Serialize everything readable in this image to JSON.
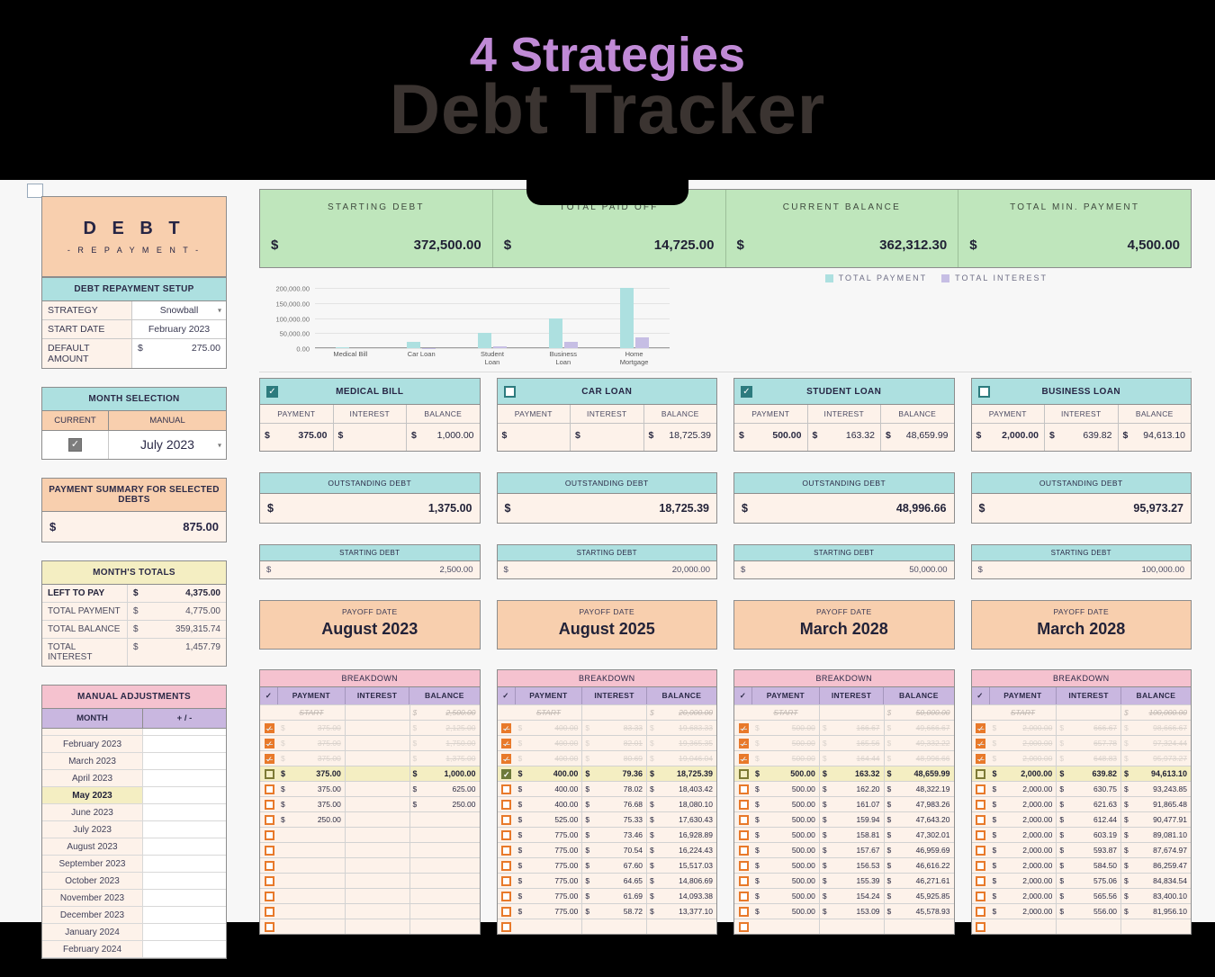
{
  "header": {
    "subtitle": "4 Strategies",
    "title": "Debt Tracker",
    "subtitle_color": "#c08ad6",
    "title_color": "#3b3431"
  },
  "sidebar": {
    "hero": {
      "line1": "D E B T",
      "line2": "- R E P A Y M E N T -"
    },
    "setup": {
      "title": "DEBT REPAYMENT SETUP",
      "rows": [
        {
          "label": "STRATEGY",
          "value": "Snowball",
          "type": "dropdown"
        },
        {
          "label": "START DATE",
          "value": "February 2023",
          "type": "text"
        },
        {
          "label": "DEFAULT AMOUNT",
          "value": "275.00",
          "currency": "$",
          "type": "money"
        }
      ]
    },
    "month_selection": {
      "title": "MONTH SELECTION",
      "col_current": "CURRENT",
      "col_manual": "MANUAL",
      "current_checked": true,
      "manual_month": "July 2023"
    },
    "payment_summary": {
      "title": "PAYMENT SUMMARY FOR SELECTED DEBTS",
      "currency": "$",
      "value": "875.00"
    },
    "months_totals": {
      "title": "MONTH'S TOTALS",
      "rows": [
        {
          "label": "LEFT TO PAY",
          "currency": "$",
          "value": "4,375.00",
          "bold": true
        },
        {
          "label": "TOTAL PAYMENT",
          "currency": "$",
          "value": "4,775.00",
          "bold": false
        },
        {
          "label": "TOTAL BALANCE",
          "currency": "$",
          "value": "359,315.74",
          "bold": false
        },
        {
          "label": "TOTAL INTEREST",
          "currency": "$",
          "value": "1,457.79",
          "bold": false
        }
      ]
    },
    "manual_adjustments": {
      "title": "MANUAL ADJUSTMENTS",
      "col_month": "MONTH",
      "col_adjust": "+ / -",
      "rows": [
        {
          "month": "",
          "value": "",
          "highlight": false
        },
        {
          "month": "February 2023",
          "value": "",
          "highlight": false
        },
        {
          "month": "March 2023",
          "value": "",
          "highlight": false
        },
        {
          "month": "April 2023",
          "value": "",
          "highlight": false
        },
        {
          "month": "May 2023",
          "value": "",
          "highlight": true
        },
        {
          "month": "June 2023",
          "value": "",
          "highlight": false
        },
        {
          "month": "July 2023",
          "value": "",
          "highlight": false
        },
        {
          "month": "August 2023",
          "value": "",
          "highlight": false
        },
        {
          "month": "September 2023",
          "value": "",
          "highlight": false
        },
        {
          "month": "October 2023",
          "value": "",
          "highlight": false
        },
        {
          "month": "November 2023",
          "value": "",
          "highlight": false
        },
        {
          "month": "December 2023",
          "value": "",
          "highlight": false
        },
        {
          "month": "January 2024",
          "value": "",
          "highlight": false
        },
        {
          "month": "February 2024",
          "value": "",
          "highlight": false
        }
      ]
    }
  },
  "summary_bar": {
    "items": [
      {
        "label": "STARTING  DEBT",
        "currency": "$",
        "value": "372,500.00"
      },
      {
        "label": "TOTAL PAID OFF",
        "currency": "$",
        "value": "14,725.00"
      },
      {
        "label": "CURRENT   BALANCE",
        "currency": "$",
        "value": "362,312.30"
      },
      {
        "label": "TOTAL MIN. PAYMENT",
        "currency": "$",
        "value": "4,500.00"
      }
    ]
  },
  "chart_data": {
    "type": "bar",
    "title": "",
    "categories": [
      "Medical Bill",
      "Car Loan",
      "Student\nLoan",
      "Business\nLoan",
      "Home\nMortgage"
    ],
    "series": [
      {
        "name": "TOTAL PAYMENT",
        "color": "#ade0e0",
        "values": [
          2500,
          20000,
          50000,
          100000,
          200000
        ]
      },
      {
        "name": "TOTAL INTEREST",
        "color": "#c6bee4",
        "values": [
          0,
          700,
          6000,
          20000,
          36000
        ]
      }
    ],
    "ylim": [
      0,
      200000
    ],
    "yticks": [
      "0.00",
      "50,000.00",
      "100,000.00",
      "150,000.00",
      "200,000.00"
    ],
    "ytick_values": [
      0,
      50000,
      100000,
      150000,
      200000
    ],
    "xlabel": "",
    "ylabel": "",
    "grid": true,
    "legend_position": "top-right"
  },
  "debts": [
    {
      "name": "MEDICAL BILL",
      "selected": true,
      "col_payment": "PAYMENT",
      "col_interest": "INTEREST",
      "col_balance": "BALANCE",
      "payment": "375.00",
      "interest": "",
      "balance": "1,000.00",
      "outstanding_label": "OUTSTANDING DEBT",
      "outstanding": "1,375.00",
      "starting_label": "STARTING DEBT",
      "starting": "2,500.00",
      "payoff_label": "PAYOFF DATE",
      "payoff": "August 2023",
      "breakdown_title": "BREAKDOWN",
      "breakdown": [
        {
          "state": "start",
          "payment": "START",
          "interest": "",
          "balance": "2,500.00"
        },
        {
          "state": "paid",
          "payment": "375.00",
          "interest": "",
          "balance": "2,125.00"
        },
        {
          "state": "paid",
          "payment": "375.00",
          "interest": "",
          "balance": "1,750.00"
        },
        {
          "state": "paid",
          "payment": "375.00",
          "interest": "",
          "balance": "1,375.00"
        },
        {
          "state": "current",
          "payment": "375.00",
          "interest": "",
          "balance": "1,000.00",
          "checked": false
        },
        {
          "state": "future",
          "payment": "375.00",
          "interest": "",
          "balance": "625.00"
        },
        {
          "state": "future",
          "payment": "375.00",
          "interest": "",
          "balance": "250.00"
        },
        {
          "state": "future",
          "payment": "250.00",
          "interest": "",
          "balance": ""
        },
        {
          "state": "empty",
          "payment": "",
          "interest": "",
          "balance": ""
        },
        {
          "state": "empty",
          "payment": "",
          "interest": "",
          "balance": ""
        },
        {
          "state": "empty",
          "payment": "",
          "interest": "",
          "balance": ""
        },
        {
          "state": "empty",
          "payment": "",
          "interest": "",
          "balance": ""
        },
        {
          "state": "empty",
          "payment": "",
          "interest": "",
          "balance": ""
        },
        {
          "state": "empty",
          "payment": "",
          "interest": "",
          "balance": ""
        },
        {
          "state": "empty",
          "payment": "",
          "interest": "",
          "balance": ""
        }
      ]
    },
    {
      "name": "CAR LOAN",
      "selected": false,
      "col_payment": "PAYMENT",
      "col_interest": "INTEREST",
      "col_balance": "BALANCE",
      "payment": "",
      "interest": "",
      "balance": "18,725.39",
      "outstanding_label": "OUTSTANDING DEBT",
      "outstanding": "18,725.39",
      "starting_label": "STARTING DEBT",
      "starting": "20,000.00",
      "payoff_label": "PAYOFF DATE",
      "payoff": "August 2025",
      "breakdown_title": "BREAKDOWN",
      "breakdown": [
        {
          "state": "start",
          "payment": "START",
          "interest": "",
          "balance": "20,000.00"
        },
        {
          "state": "paid",
          "payment": "400.00",
          "interest": "83.33",
          "balance": "19,683.33"
        },
        {
          "state": "paid",
          "payment": "400.00",
          "interest": "82.01",
          "balance": "19,365.35"
        },
        {
          "state": "paid",
          "payment": "400.00",
          "interest": "80.69",
          "balance": "19,046.04"
        },
        {
          "state": "current",
          "payment": "400.00",
          "interest": "79.36",
          "balance": "18,725.39",
          "checked": true
        },
        {
          "state": "future",
          "payment": "400.00",
          "interest": "78.02",
          "balance": "18,403.42"
        },
        {
          "state": "future",
          "payment": "400.00",
          "interest": "76.68",
          "balance": "18,080.10"
        },
        {
          "state": "future",
          "payment": "525.00",
          "interest": "75.33",
          "balance": "17,630.43"
        },
        {
          "state": "future",
          "payment": "775.00",
          "interest": "73.46",
          "balance": "16,928.89"
        },
        {
          "state": "future",
          "payment": "775.00",
          "interest": "70.54",
          "balance": "16,224.43"
        },
        {
          "state": "future",
          "payment": "775.00",
          "interest": "67.60",
          "balance": "15,517.03"
        },
        {
          "state": "future",
          "payment": "775.00",
          "interest": "64.65",
          "balance": "14,806.69"
        },
        {
          "state": "future",
          "payment": "775.00",
          "interest": "61.69",
          "balance": "14,093.38"
        },
        {
          "state": "future",
          "payment": "775.00",
          "interest": "58.72",
          "balance": "13,377.10"
        },
        {
          "state": "future",
          "payment": "",
          "interest": "",
          "balance": ""
        }
      ]
    },
    {
      "name": "STUDENT LOAN",
      "selected": true,
      "col_payment": "PAYMENT",
      "col_interest": "INTEREST",
      "col_balance": "BALANCE",
      "payment": "500.00",
      "interest": "163.32",
      "balance": "48,659.99",
      "outstanding_label": "OUTSTANDING DEBT",
      "outstanding": "48,996.66",
      "starting_label": "STARTING DEBT",
      "starting": "50,000.00",
      "payoff_label": "PAYOFF DATE",
      "payoff": "March 2028",
      "breakdown_title": "BREAKDOWN",
      "breakdown": [
        {
          "state": "start",
          "payment": "START",
          "interest": "",
          "balance": "50,000.00"
        },
        {
          "state": "paid",
          "payment": "500.00",
          "interest": "166.67",
          "balance": "49,666.67"
        },
        {
          "state": "paid",
          "payment": "500.00",
          "interest": "165.56",
          "balance": "49,332.22"
        },
        {
          "state": "paid",
          "payment": "500.00",
          "interest": "164.44",
          "balance": "48,996.66"
        },
        {
          "state": "current",
          "payment": "500.00",
          "interest": "163.32",
          "balance": "48,659.99",
          "checked": false
        },
        {
          "state": "future",
          "payment": "500.00",
          "interest": "162.20",
          "balance": "48,322.19"
        },
        {
          "state": "future",
          "payment": "500.00",
          "interest": "161.07",
          "balance": "47,983.26"
        },
        {
          "state": "future",
          "payment": "500.00",
          "interest": "159.94",
          "balance": "47,643.20"
        },
        {
          "state": "future",
          "payment": "500.00",
          "interest": "158.81",
          "balance": "47,302.01"
        },
        {
          "state": "future",
          "payment": "500.00",
          "interest": "157.67",
          "balance": "46,959.69"
        },
        {
          "state": "future",
          "payment": "500.00",
          "interest": "156.53",
          "balance": "46,616.22"
        },
        {
          "state": "future",
          "payment": "500.00",
          "interest": "155.39",
          "balance": "46,271.61"
        },
        {
          "state": "future",
          "payment": "500.00",
          "interest": "154.24",
          "balance": "45,925.85"
        },
        {
          "state": "future",
          "payment": "500.00",
          "interest": "153.09",
          "balance": "45,578.93"
        },
        {
          "state": "future",
          "payment": "",
          "interest": "",
          "balance": ""
        }
      ]
    },
    {
      "name": "BUSINESS LOAN",
      "selected": false,
      "col_payment": "PAYMENT",
      "col_interest": "INTEREST",
      "col_balance": "BALANCE",
      "payment": "2,000.00",
      "interest": "639.82",
      "balance": "94,613.10",
      "outstanding_label": "OUTSTANDING DEBT",
      "outstanding": "95,973.27",
      "starting_label": "STARTING DEBT",
      "starting": "100,000.00",
      "payoff_label": "PAYOFF DATE",
      "payoff": "March 2028",
      "breakdown_title": "BREAKDOWN",
      "breakdown": [
        {
          "state": "start",
          "payment": "START",
          "interest": "",
          "balance": "100,000.00"
        },
        {
          "state": "paid",
          "payment": "2,000.00",
          "interest": "666.67",
          "balance": "98,666.67"
        },
        {
          "state": "paid",
          "payment": "2,000.00",
          "interest": "657.78",
          "balance": "97,324.44"
        },
        {
          "state": "paid",
          "payment": "2,000.00",
          "interest": "648.83",
          "balance": "95,973.27"
        },
        {
          "state": "current",
          "payment": "2,000.00",
          "interest": "639.82",
          "balance": "94,613.10",
          "checked": false
        },
        {
          "state": "future",
          "payment": "2,000.00",
          "interest": "630.75",
          "balance": "93,243.85"
        },
        {
          "state": "future",
          "payment": "2,000.00",
          "interest": "621.63",
          "balance": "91,865.48"
        },
        {
          "state": "future",
          "payment": "2,000.00",
          "interest": "612.44",
          "balance": "90,477.91"
        },
        {
          "state": "future",
          "payment": "2,000.00",
          "interest": "603.19",
          "balance": "89,081.10"
        },
        {
          "state": "future",
          "payment": "2,000.00",
          "interest": "593.87",
          "balance": "87,674.97"
        },
        {
          "state": "future",
          "payment": "2,000.00",
          "interest": "584.50",
          "balance": "86,259.47"
        },
        {
          "state": "future",
          "payment": "2,000.00",
          "interest": "575.06",
          "balance": "84,834.54"
        },
        {
          "state": "future",
          "payment": "2,000.00",
          "interest": "565.56",
          "balance": "83,400.10"
        },
        {
          "state": "future",
          "payment": "2,000.00",
          "interest": "556.00",
          "balance": "81,956.10"
        },
        {
          "state": "future",
          "payment": "",
          "interest": "",
          "balance": ""
        }
      ]
    }
  ]
}
